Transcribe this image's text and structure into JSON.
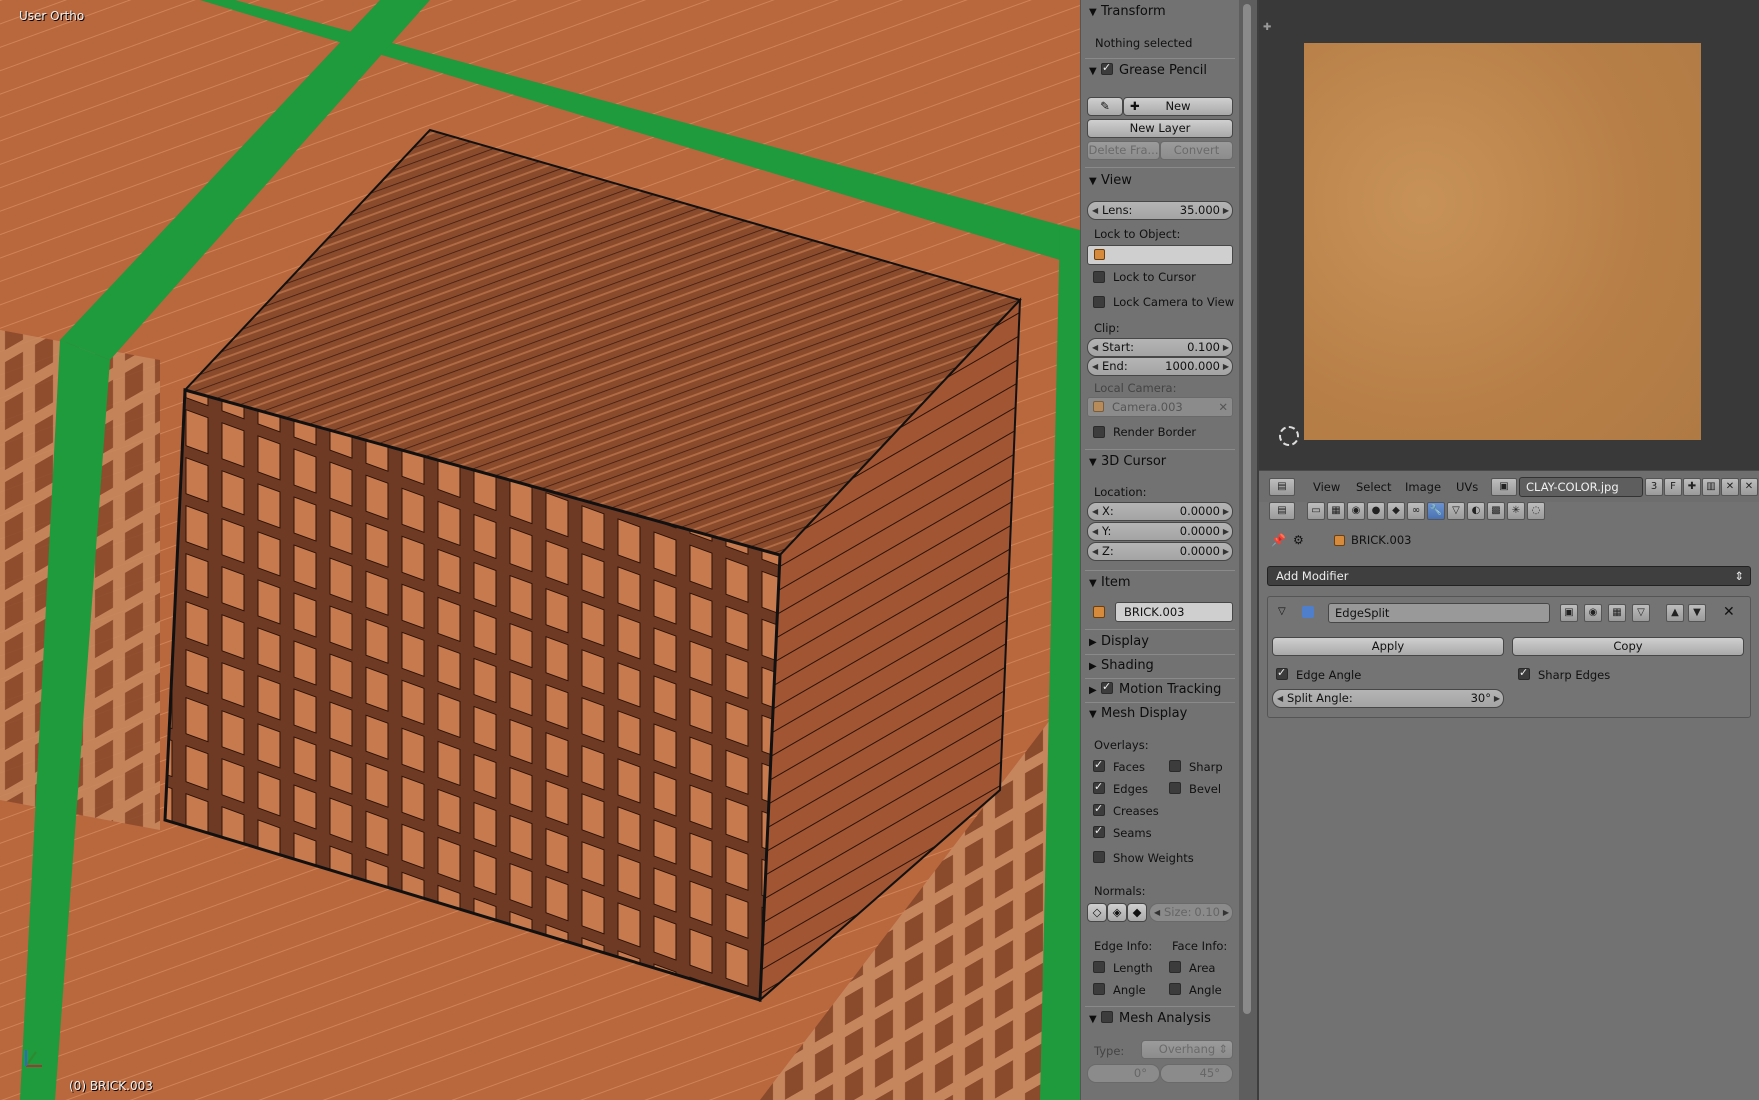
{
  "viewport": {
    "view_label": "User Ortho",
    "object_label": "(0) BRICK.003"
  },
  "npanel": {
    "transform": {
      "header": "Transform",
      "status": "Nothing selected"
    },
    "grease_pencil": {
      "header": "Grease Pencil",
      "enabled": true,
      "new_label": "New",
      "new_layer_label": "New Layer",
      "delete_frame_label": "Delete Fra...",
      "convert_label": "Convert"
    },
    "view": {
      "header": "View",
      "lens_label": "Lens:",
      "lens_value": "35.000",
      "lock_to_object_label": "Lock to Object:",
      "lock_to_cursor_label": "Lock to Cursor",
      "lock_camera_label": "Lock Camera to View",
      "clip_label": "Clip:",
      "start_label": "Start:",
      "start_value": "0.100",
      "end_label": "End:",
      "end_value": "1000.000",
      "local_camera_label": "Local Camera:",
      "local_camera_value": "Camera.003",
      "render_border_label": "Render Border"
    },
    "cursor": {
      "header": "3D Cursor",
      "location_label": "Location:",
      "x_label": "X:",
      "x_value": "0.0000",
      "y_label": "Y:",
      "y_value": "0.0000",
      "z_label": "Z:",
      "z_value": "0.0000"
    },
    "item": {
      "header": "Item",
      "name": "BRICK.003"
    },
    "display": {
      "header": "Display"
    },
    "shading": {
      "header": "Shading"
    },
    "motion_tracking": {
      "header": "Motion Tracking",
      "enabled": true
    },
    "mesh_display": {
      "header": "Mesh Display",
      "overlays_label": "Overlays:",
      "faces": "Faces",
      "sharp": "Sharp",
      "edges": "Edges",
      "bevel": "Bevel",
      "creases": "Creases",
      "seams": "Seams",
      "show_weights": "Show Weights",
      "normals_label": "Normals:",
      "size_label": "Size:",
      "size_value": "0.10",
      "edge_info_label": "Edge Info:",
      "face_info_label": "Face Info:",
      "length": "Length",
      "area": "Area",
      "edge_angle": "Angle",
      "face_angle": "Angle"
    },
    "mesh_analysis": {
      "header": "Mesh Analysis",
      "type_label": "Type:",
      "type_value": "Overhang",
      "min_value": "0°",
      "max_value": "45°"
    }
  },
  "image_editor": {
    "menus": [
      "View",
      "Select",
      "Image",
      "UVs"
    ],
    "image_name": "CLAY-COLOR.jpg",
    "users": "3",
    "fake_user": "F"
  },
  "properties": {
    "object_name": "BRICK.003",
    "add_modifier_label": "Add Modifier",
    "modifier": {
      "name": "EdgeSplit",
      "apply_label": "Apply",
      "copy_label": "Copy",
      "edge_angle_label": "Edge Angle",
      "sharp_edges_label": "Sharp Edges",
      "split_angle_label": "Split Angle:",
      "split_angle_value": "30°"
    }
  },
  "colors": {
    "panel_bg": "#727272",
    "brick": "#b8653a",
    "strap_green": "#1f9a3c",
    "accent_blue": "#5680c2"
  }
}
